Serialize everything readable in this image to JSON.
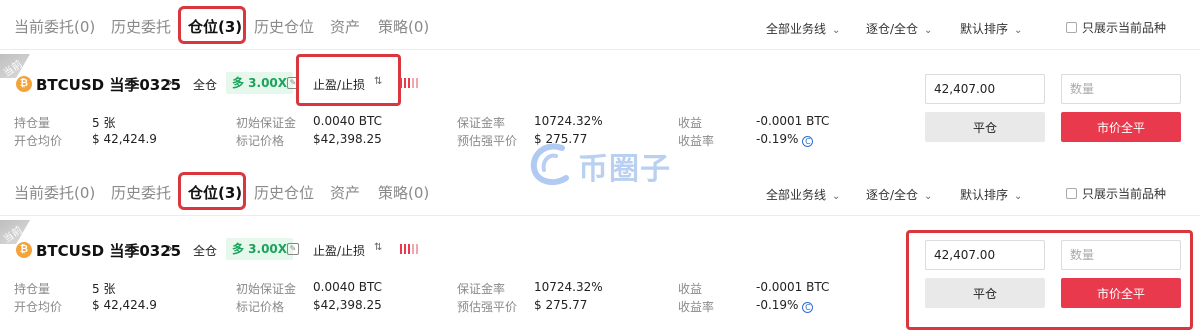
{
  "tabs": [
    {
      "label": "当前委托(0)",
      "active": false
    },
    {
      "label": "历史委托",
      "active": false
    },
    {
      "label": "仓位(3)",
      "active": true
    },
    {
      "label": "历史仓位",
      "active": false
    },
    {
      "label": "资产",
      "active": false
    },
    {
      "label": "策略(0)",
      "active": false
    }
  ],
  "filters": {
    "business_line": "全部业务线",
    "margin_mode": "逐仓/全仓",
    "sort": "默认排序",
    "only_current": "只展示当前品种",
    "chevron": "⌄"
  },
  "position": {
    "badge": "当前",
    "coin_icon": "bitcoin-icon",
    "coin_glyph": "₿",
    "symbol": "BTCUSD 当季0325",
    "symbol_chevron": "›",
    "margin_type": "全仓",
    "leverage": "多 3.00X",
    "edit_glyph": "✎",
    "tpsl_label": "止盈/止损",
    "tpsl_glyph": "⇅",
    "bar_colors": [
      "#e83a4c",
      "#e83a4c",
      "#e83a4c",
      "#f2a6ae",
      "#f2a6ae"
    ],
    "fields": {
      "holdings_label": "持仓量",
      "holdings_value": "5 张",
      "avg_open_label": "开仓均价",
      "avg_open_value": "$ 42,424.9",
      "init_margin_label": "初始保证金",
      "init_margin_value": "0.0040 BTC",
      "mark_price_label": "标记价格",
      "mark_price_value": "$42,398.25",
      "margin_ratio_label": "保证金率",
      "margin_ratio_value": "10724.32%",
      "est_liq_label": "预估强平价",
      "est_liq_value": "$ 275.77",
      "pnl_label": "收益",
      "pnl_value": "-0.0001 BTC",
      "pnl_rate_label": "收益率",
      "pnl_rate_value": "-0.19%",
      "help_glyph": "C"
    },
    "price_input_value": "42,407.00",
    "qty_placeholder": "数量",
    "close_label": "平仓",
    "market_close_label": "市价全平"
  },
  "watermark": {
    "text": "币圈子"
  },
  "colors": {
    "highlight": "#d9363e",
    "long_green": "#1aa35b",
    "market_red": "#e83a4c",
    "coin_orange": "#f3a33a"
  }
}
